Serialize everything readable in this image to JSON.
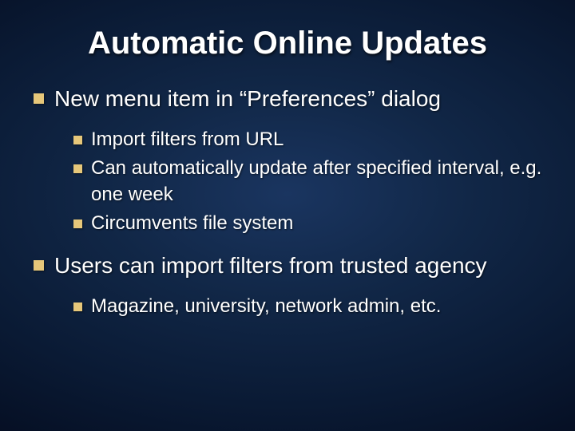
{
  "title": "Automatic Online Updates",
  "bullets": {
    "b1": "New menu item in “Preferences” dialog",
    "b1_1": "Import filters from URL",
    "b1_2": "Can automatically update after specified interval, e.g. one week",
    "b1_3": "Circumvents file system",
    "b2": "Users can import filters from trusted agency",
    "b2_1": "Magazine, university, network admin, etc."
  }
}
